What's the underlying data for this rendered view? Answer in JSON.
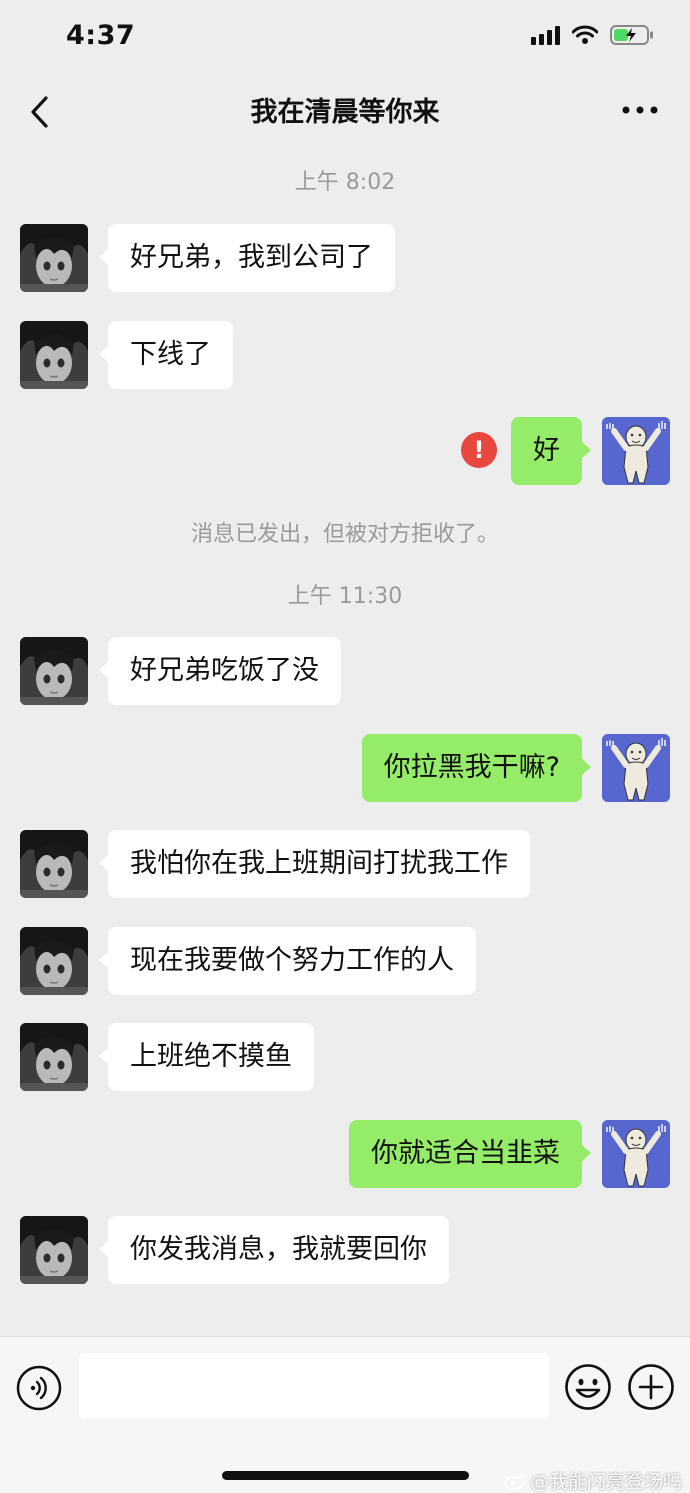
{
  "status_bar": {
    "time": "4:37"
  },
  "nav": {
    "title": "我在清晨等你来"
  },
  "chat": {
    "timestamps": [
      "上午 8:02",
      "上午 11:30"
    ],
    "system_note": "消息已发出，但被对方拒收了。",
    "messages": [
      {
        "side": "in",
        "text": "好兄弟，我到公司了"
      },
      {
        "side": "in",
        "text": "下线了"
      },
      {
        "side": "out",
        "text": "好",
        "failed": true
      },
      {
        "side": "in",
        "text": "好兄弟吃饭了没"
      },
      {
        "side": "out",
        "text": "你拉黑我干嘛?"
      },
      {
        "side": "in",
        "text": "我怕你在我上班期间打扰我工作"
      },
      {
        "side": "in",
        "text": "现在我要做个努力工作的人"
      },
      {
        "side": "in",
        "text": "上班绝不摸鱼"
      },
      {
        "side": "out",
        "text": "你就适合当韭菜"
      },
      {
        "side": "in",
        "text": "你发我消息，我就要回你"
      }
    ]
  },
  "input_bar": {
    "value": ""
  },
  "watermark": "@我能闪亮登场吗",
  "colors": {
    "background": "#ededed",
    "incoming_bubble": "#ffffff",
    "outgoing_bubble": "#95ec69",
    "error": "#e8473e",
    "timestamp_text": "#9a9a9a"
  },
  "icons": [
    "back-icon",
    "more-icon",
    "voice-icon",
    "emoji-icon",
    "plus-icon",
    "error-icon",
    "weibo-icon"
  ]
}
